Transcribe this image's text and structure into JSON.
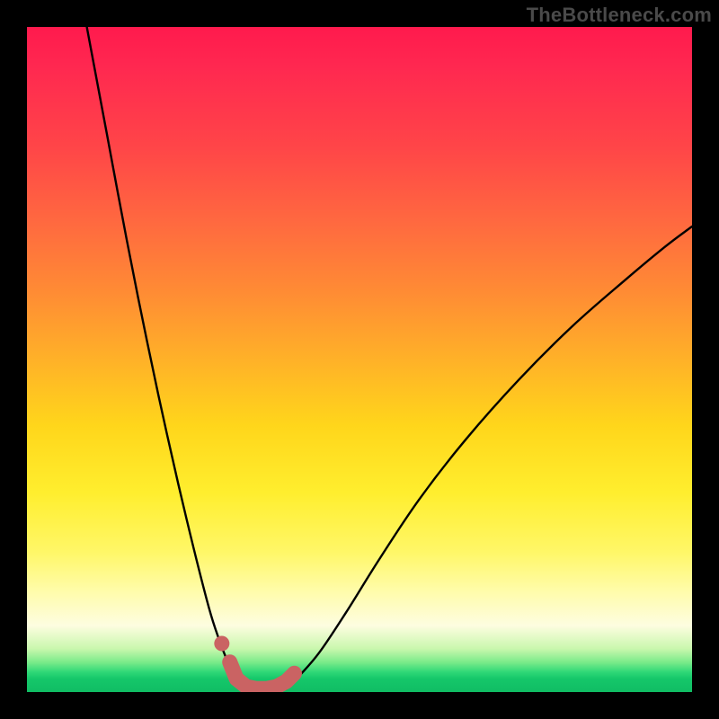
{
  "watermark": "TheBottleneck.com",
  "colors": {
    "frame": "#000000",
    "curve": "#000000",
    "marker_fill": "#ca6363",
    "marker_stroke": "#c05858"
  },
  "chart_data": {
    "type": "line",
    "title": "",
    "xlabel": "",
    "ylabel": "",
    "xlim": [
      0,
      100
    ],
    "ylim": [
      0,
      100
    ],
    "grid": false,
    "legend": false,
    "annotations": [
      {
        "text": "TheBottleneck.com",
        "position": "top-right"
      }
    ],
    "series": [
      {
        "name": "left-branch",
        "x": [
          9,
          12,
          15,
          18,
          21,
          24,
          27,
          28.5,
          30,
          31.5,
          33
        ],
        "y": [
          100,
          84,
          68,
          53,
          39,
          26,
          14,
          9,
          5,
          2,
          0.5
        ]
      },
      {
        "name": "right-branch",
        "x": [
          39,
          41,
          44,
          48,
          53,
          59,
          66,
          74,
          82,
          90,
          96,
          100
        ],
        "y": [
          0.5,
          2.5,
          6,
          12,
          20,
          29,
          38,
          47,
          55,
          62,
          67,
          70
        ]
      }
    ],
    "markers": {
      "name": "valley-floor",
      "points": [
        {
          "x": 30.5,
          "y": 4.5
        },
        {
          "x": 31.5,
          "y": 2.0
        },
        {
          "x": 33.0,
          "y": 0.8
        },
        {
          "x": 34.5,
          "y": 0.5
        },
        {
          "x": 36.0,
          "y": 0.5
        },
        {
          "x": 37.5,
          "y": 0.8
        },
        {
          "x": 39.0,
          "y": 1.6
        },
        {
          "x": 40.2,
          "y": 2.8
        }
      ]
    }
  }
}
